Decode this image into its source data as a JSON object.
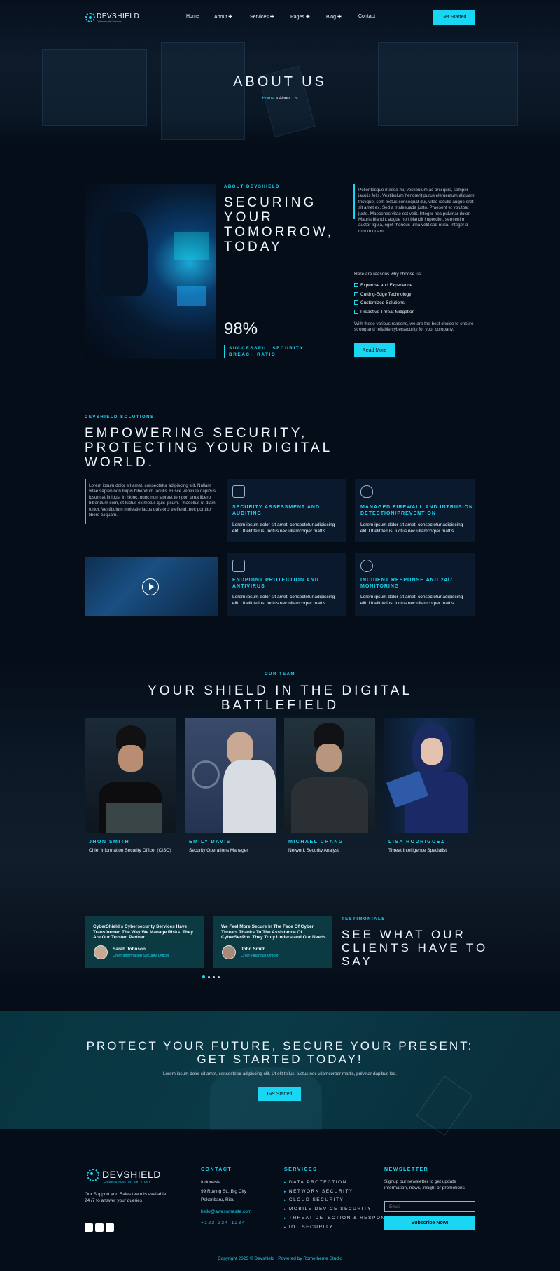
{
  "brand": {
    "name": "DEVSHIELD",
    "tagline": "Cybersecurity Services"
  },
  "nav": {
    "items": [
      "Home",
      "About",
      "Services",
      "Pages",
      "Blog",
      "Contact"
    ],
    "cta": "Get Started"
  },
  "hero": {
    "title": "ABOUT US",
    "crumb_home": "Home",
    "crumb_sep": "»",
    "crumb_current": "About Us"
  },
  "about": {
    "eyebrow": "ABOUT DEVSHIELD",
    "title_lines": [
      "SECURING",
      "YOUR",
      "TOMORROW,",
      "TODAY"
    ],
    "stat_value": "98%",
    "stat_label_1": "SUCCESSFUL SECURITY",
    "stat_label_2": "BREACH RATIO",
    "paragraph": "Pellentesque massa mi, vestibulum ac orci quis, semper iaculis felis. Vestibulum hendrerit purus elementum aliquam tristique, sem lectus consequat dui, vitae iaculis augue erat sit amet ex. Sed a malesuada justo. Praesent et volutpat justo. Maecenas vitae est velit. Integer nec pulvinar dolor. Mauris blandit, augue non blandit imperdiet, sem enim auctor ligula, eget rhoncus urna velit sed nulla. Integer a rutrum quam.",
    "reasons_intro": "Here are reasons why choose us:",
    "reasons": [
      "Expertise and Experience",
      "Cutting-Edge Technology",
      "Customized Solutions",
      "Proactive Threat Mitigation"
    ],
    "closing": "With these various reasons, we are the best choice to ensure strong and reliable cybersecurity for your company.",
    "button": "Read More"
  },
  "solutions": {
    "eyebrow": "DEVSHIELD SOLUTIONS",
    "title_lines": [
      "EMPOWERING SECURITY,",
      "PROTECTING YOUR DIGITAL",
      "WORLD."
    ],
    "paragraph": "Lorem ipsum dolor sit amet, consectetur adipiscing elit. Nullam vitae sapien non turpis bibendum iaculis. Fusce vehicula dapibus ipsum at finibus. In hionc, nunc non laoreet tempor, urna libero bibendum sem, et luctus ex metus quis ipsum. Phasellus ut diam tortor. Vestibulum molestie lacus quis orci eleifend, nec porttitor libero aliquam.",
    "cards": [
      {
        "title_1": "SECURITY ASSESSMENT AND",
        "title_2": "AUDITING",
        "text_1": "Lorem ipsum dolor sit amet, consectetur adipiscing",
        "text_2": "elit. Ut elit tellus, luctus nec ullamcorper mattis."
      },
      {
        "title_1": "MANAGED FIREWALL AND INTRUSION",
        "title_2": "DETECTION/PREVENTION",
        "text_1": "Lorem ipsum dolor sit amet, consectetur adipiscing",
        "text_2": "elit. Ut elit tellus, luctus nec ullamcorper mattis."
      },
      {
        "title_1": "ENDPOINT PROTECTION AND",
        "title_2": "ANTIVIRUS",
        "text_1": "Lorem ipsum dolor sit amet, consectetur adipiscing",
        "text_2": "elit. Ut elit tellus, luctus nec ullamcorper mattis."
      },
      {
        "title_1": "INCIDENT RESPONSE AND 24/7",
        "title_2": "MONITORING",
        "text_1": "Lorem ipsum dolor sit amet, consectetur adipiscing",
        "text_2": "elit. Ut elit tellus, luctus nec ullamcorper mattis."
      }
    ]
  },
  "team": {
    "eyebrow": "OUR TEAM",
    "title_1": "YOUR SHIELD IN THE DIGITAL",
    "title_2": "BATTLEFIELD",
    "members": [
      {
        "name": "JHON SMITH",
        "role": "Chief Information Security Officer (CISO)"
      },
      {
        "name": "EMILY DAVIS",
        "role": "Security Operations Manager"
      },
      {
        "name": "MICHAEL CHANG",
        "role": "Network Security Analyst"
      },
      {
        "name": "LISA RODRIGUEZ",
        "role": "Threat Intelligence Specialist"
      }
    ]
  },
  "testimonials": {
    "eyebrow": "TESTIMONIALS",
    "title_lines": [
      "SEE WHAT OUR",
      "CLIENTS HAVE TO",
      "SAY"
    ],
    "items": [
      {
        "quote_1": "CyberShield's Cybersecurity Services Have",
        "quote_2": "Transformed The Way We Manage Risks. They",
        "quote_3": "Are Our Trusted Partner.",
        "name": "Sarah Johnson",
        "role": "Chief Information Security Officer"
      },
      {
        "quote_1": "We Feel More Secure In The Face Of Cyber",
        "quote_2": "Threats Thanks To The Assistance Of",
        "quote_3": "CyberSecPro. They Truly Understand Our Needs.",
        "name": "John Smith",
        "role": "Chief Financial Officer"
      }
    ]
  },
  "cta": {
    "title_1": "PROTECT YOUR FUTURE, SECURE YOUR PRESENT:",
    "title_2": "GET STARTED TODAY!",
    "text": "Lorem ipsum dolor sit amet, consectetur adipiscing elit. Ut elit tellus, luctus nec ullamcorper mattis, pulvinar dapibus leo.",
    "button": "Get Started"
  },
  "footer": {
    "about_1": "Our Support and Sales team is available",
    "about_2": "24 /7 to answer your queries",
    "contact_heading": "CONTACT",
    "address_1": "Indonesia",
    "address_2": "99 Roving St., Big City",
    "address_3": "Pekanbaru, Riau",
    "email": "hello@awesomesite.com",
    "phone": "+123-234-1234",
    "services_heading": "SERVICES",
    "services": [
      "DATA PROTECTION",
      "NETWORK SECURITY",
      "CLOUD SECURITY",
      "MOBILE DEVICE SECURITY",
      "THREAT DETECTION & RESPONS",
      "IOT SECURITY"
    ],
    "newsletter_heading": "NEWSLETTER",
    "newsletter_1": "Signup our newsletter to get update",
    "newsletter_2": "information, news, insight or promotions.",
    "email_placeholder": "Email",
    "subscribe": "Subscribe Now!",
    "copyright": "Copyright 2023 © Devshield | Powered by Rometheme Studio"
  },
  "colors": {
    "accent": "#19d6f2",
    "background": "#050d18",
    "card": "#0a1a2c",
    "testimonial": "#0c3a42"
  },
  "icons": [
    "plus-icon",
    "shield-icon",
    "lock-icon",
    "chip-icon",
    "alert-icon",
    "play-icon",
    "facebook-icon",
    "twitter-icon",
    "instagram-icon"
  ]
}
